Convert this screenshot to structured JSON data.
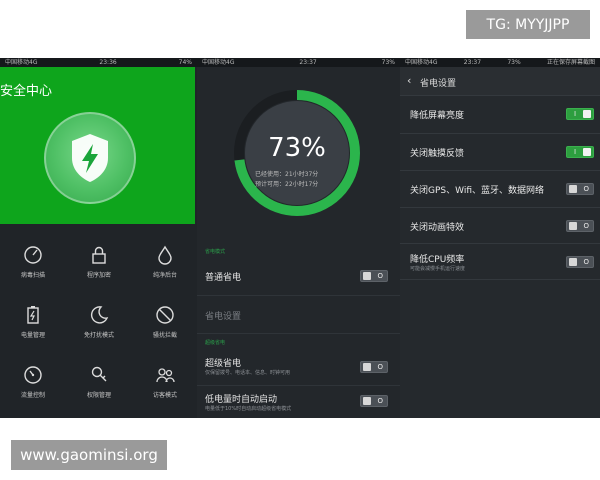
{
  "watermarks": {
    "tg": "TG: MYYJJPP",
    "site": "www.gaominsi.org"
  },
  "panel1": {
    "status": {
      "carrier": "中国移动4G",
      "time": "23:36",
      "battery": "74%"
    },
    "title": "安全中心",
    "grid": [
      {
        "label": "病毒扫描",
        "icon": "speedometer-icon"
      },
      {
        "label": "程序加密",
        "icon": "lock-icon"
      },
      {
        "label": "纯净后台",
        "icon": "droplet-icon"
      },
      {
        "label": "电量管理",
        "icon": "battery-icon"
      },
      {
        "label": "免打扰模式",
        "icon": "moon-icon"
      },
      {
        "label": "骚扰拦截",
        "icon": "block-icon"
      },
      {
        "label": "流量控制",
        "icon": "gauge-icon"
      },
      {
        "label": "权限管理",
        "icon": "key-icon"
      },
      {
        "label": "访客模式",
        "icon": "users-icon"
      }
    ],
    "accent": "#0ea51c"
  },
  "panel2": {
    "status": {
      "carrier": "中国移动4G",
      "time": "23:37",
      "battery": "73%"
    },
    "battery_percent": 73,
    "battery_label": "73%",
    "used": "已经使用：21小时37分",
    "available": "预计可用：22小时17分",
    "section1": "省电模式",
    "normal_saving": "普通省电",
    "saving_settings": "省电设置",
    "section2": "超级省电",
    "super_saving": "超级省电",
    "super_saving_sub": "仅保留拨号、电话本、信息、时钟可用",
    "auto_low": "低电量时自动启动",
    "auto_low_sub": "电量低于10%时自动启动超级省电模式",
    "ring_color": "#2bb54c"
  },
  "panel3": {
    "status": {
      "carrier": "中国移动4G",
      "time": "23:37",
      "battery": "73%",
      "notice": "正在保存屏幕截图"
    },
    "back": "‹",
    "title": "省电设置",
    "rows": [
      {
        "label": "降低屏幕亮度",
        "on": true,
        "mark": "I"
      },
      {
        "label": "关闭触摸反馈",
        "on": true,
        "mark": "I"
      },
      {
        "label": "关闭GPS、Wifi、蓝牙、数据网络",
        "on": false,
        "mark": "O"
      },
      {
        "label": "关闭动画特效",
        "on": false,
        "mark": "O"
      },
      {
        "label": "降低CPU频率",
        "sub": "可能会减慢手机运行速度",
        "on": false,
        "mark": "O"
      }
    ]
  },
  "toggle_marks": {
    "off": "O"
  }
}
